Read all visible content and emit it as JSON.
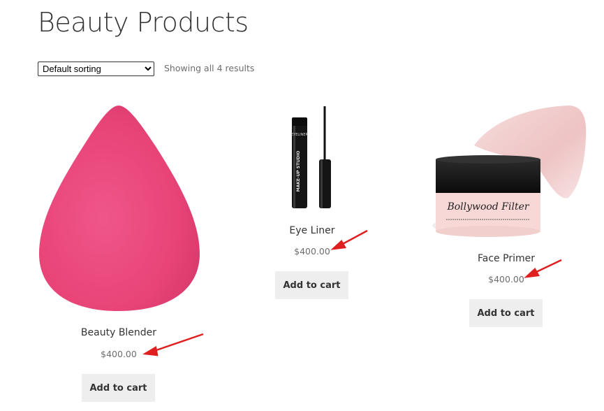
{
  "page": {
    "title": "Beauty Products"
  },
  "sorting": {
    "selected": "Default sorting",
    "options": [
      "Default sorting"
    ]
  },
  "result_count": "Showing all 4 results",
  "products": [
    {
      "name": "Beauty Blender",
      "price": "$400.00",
      "button": "Add to cart"
    },
    {
      "name": "Eye Liner",
      "price": "$400.00",
      "button": "Add to cart",
      "image_text": [
        "EYELINER",
        "MAKE-UP STUDIO"
      ]
    },
    {
      "name": "Face Primer",
      "price": "$400.00",
      "button": "Add to cart",
      "image_text": [
        "Bollywood Filter"
      ]
    }
  ],
  "colors": {
    "annotation_arrow": "#e02020",
    "button_bg": "#eeeeee",
    "blender_pink": "#e8457a"
  }
}
